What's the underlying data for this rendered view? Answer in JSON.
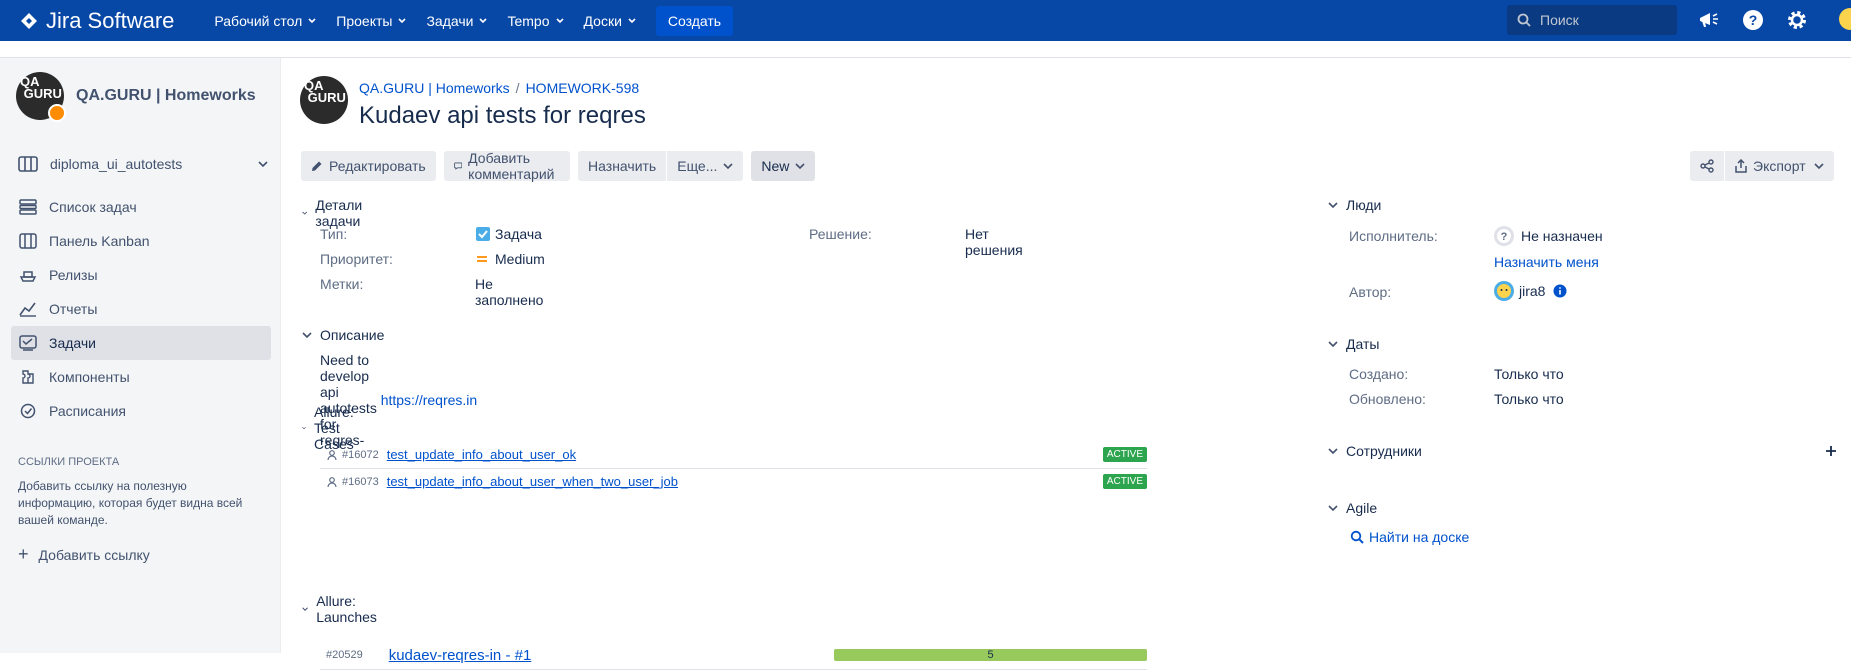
{
  "topbar": {
    "logo": "Jira Software",
    "nav": [
      "Рабочий стол",
      "Проекты",
      "Задачи",
      "Tempo",
      "Доски"
    ],
    "create": "Создать",
    "search_placeholder": "Поиск"
  },
  "sidebar": {
    "project_name": "QA.GURU | Homeworks",
    "board": "diploma_ui_autotests",
    "items": [
      {
        "label": "Список задач",
        "icon": "backlog-icon"
      },
      {
        "label": "Панель Kanban",
        "icon": "board-icon"
      },
      {
        "label": "Релизы",
        "icon": "ship-icon"
      },
      {
        "label": "Отчеты",
        "icon": "chart-icon"
      },
      {
        "label": "Задачи",
        "icon": "issues-icon",
        "active": true
      },
      {
        "label": "Компоненты",
        "icon": "component-icon"
      },
      {
        "label": "Расписания",
        "icon": "schedule-icon"
      }
    ],
    "links_heading": "Ссылки проекта",
    "links_description": "Добавить ссылку на полезную информацию, которая будет видна всей вашей команде.",
    "add_link": "Добавить ссылку"
  },
  "issue": {
    "breadcrumb_project": "QA.GURU | Homeworks",
    "breadcrumb_key": "HOMEWORK-598",
    "title": "Kudaev api tests for reqres",
    "toolbar": {
      "edit": "Редактировать",
      "comment": "Добавить комментарий",
      "assign": "Назначить",
      "more": "Еще...",
      "status": "New",
      "export": "Экспорт"
    },
    "details": {
      "heading": "Детали задачи",
      "type_label": "Тип:",
      "type_value": "Задача",
      "priority_label": "Приоритет:",
      "priority_value": "Medium",
      "labels_label": "Метки:",
      "labels_value": "Не заполнено",
      "resolution_label": "Решение:",
      "resolution_value": "Нет решения"
    },
    "description": {
      "heading": "Описание",
      "text": "Need to develop api autotests for reqres-",
      "link": "https://reqres.in"
    },
    "allure_tests": {
      "heading": "Allure: Test Cases",
      "rows": [
        {
          "id": "#16072",
          "name": "test_update_info_about_user_ok",
          "status": "ACTIVE"
        },
        {
          "id": "#16073",
          "name": "test_update_info_about_user_when_two_user_job",
          "status": "ACTIVE"
        }
      ]
    },
    "allure_launches": {
      "heading": "Allure: Launches",
      "id": "#20529",
      "name": "kudaev-reqres-in - #1",
      "count": "5"
    }
  },
  "right": {
    "people_heading": "Люди",
    "assignee_label": "Исполнитель:",
    "assignee_value": "Не назначен",
    "assign_me": "Назначить меня",
    "reporter_label": "Автор:",
    "reporter_value": "jira8",
    "dates_heading": "Даты",
    "created_label": "Создано:",
    "created_value": "Только что",
    "updated_label": "Обновлено:",
    "updated_value": "Только что",
    "team_heading": "Сотрудники",
    "agile_heading": "Agile",
    "agile_link": "Найти на доске"
  }
}
